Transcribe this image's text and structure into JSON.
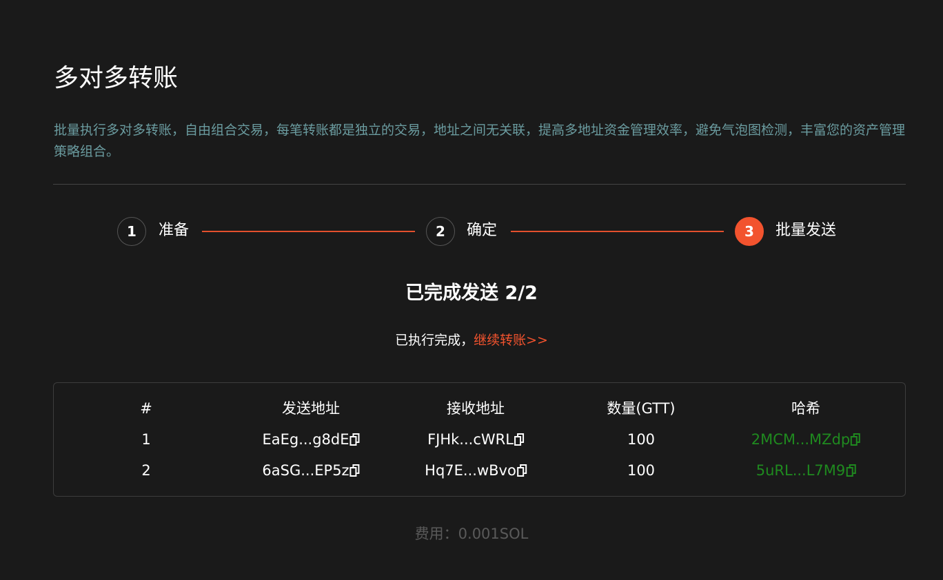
{
  "header": {
    "title": "多对多转账",
    "description": "批量执行多对多转账，自由组合交易，每笔转账都是独立的交易，地址之间无关联，提高多地址资金管理效率，避免气泡图检测，丰富您的资产管理策略组合。"
  },
  "steps": [
    {
      "number": "1",
      "label": "准备",
      "state": "done"
    },
    {
      "number": "2",
      "label": "确定",
      "state": "done"
    },
    {
      "number": "3",
      "label": "批量发送",
      "state": "active"
    }
  ],
  "result": {
    "title": "已完成发送 2/2",
    "message": "已执行完成，",
    "continue_link": "继续转账>>"
  },
  "table": {
    "headers": {
      "index": "#",
      "from": "发送地址",
      "to": "接收地址",
      "amount": "数量(GTT)",
      "hash": "哈希"
    },
    "rows": [
      {
        "index": "1",
        "from": "EaEg...g8dE",
        "to": "FJHk...cWRL",
        "amount": "100",
        "hash": "2MCM...MZdp"
      },
      {
        "index": "2",
        "from": "6aSG...EP5z",
        "to": "Hq7E...wBvo",
        "amount": "100",
        "hash": "5uRL...L7M9"
      }
    ]
  },
  "fee": {
    "text": "费用：0.001SOL"
  },
  "colors": {
    "background": "#1a1a1a",
    "accent": "#f2532e",
    "description": "#6b9ca0",
    "hash": "#1f8a1f",
    "muted": "#5a5a5a"
  },
  "icons": {
    "copy": "copy-icon"
  }
}
